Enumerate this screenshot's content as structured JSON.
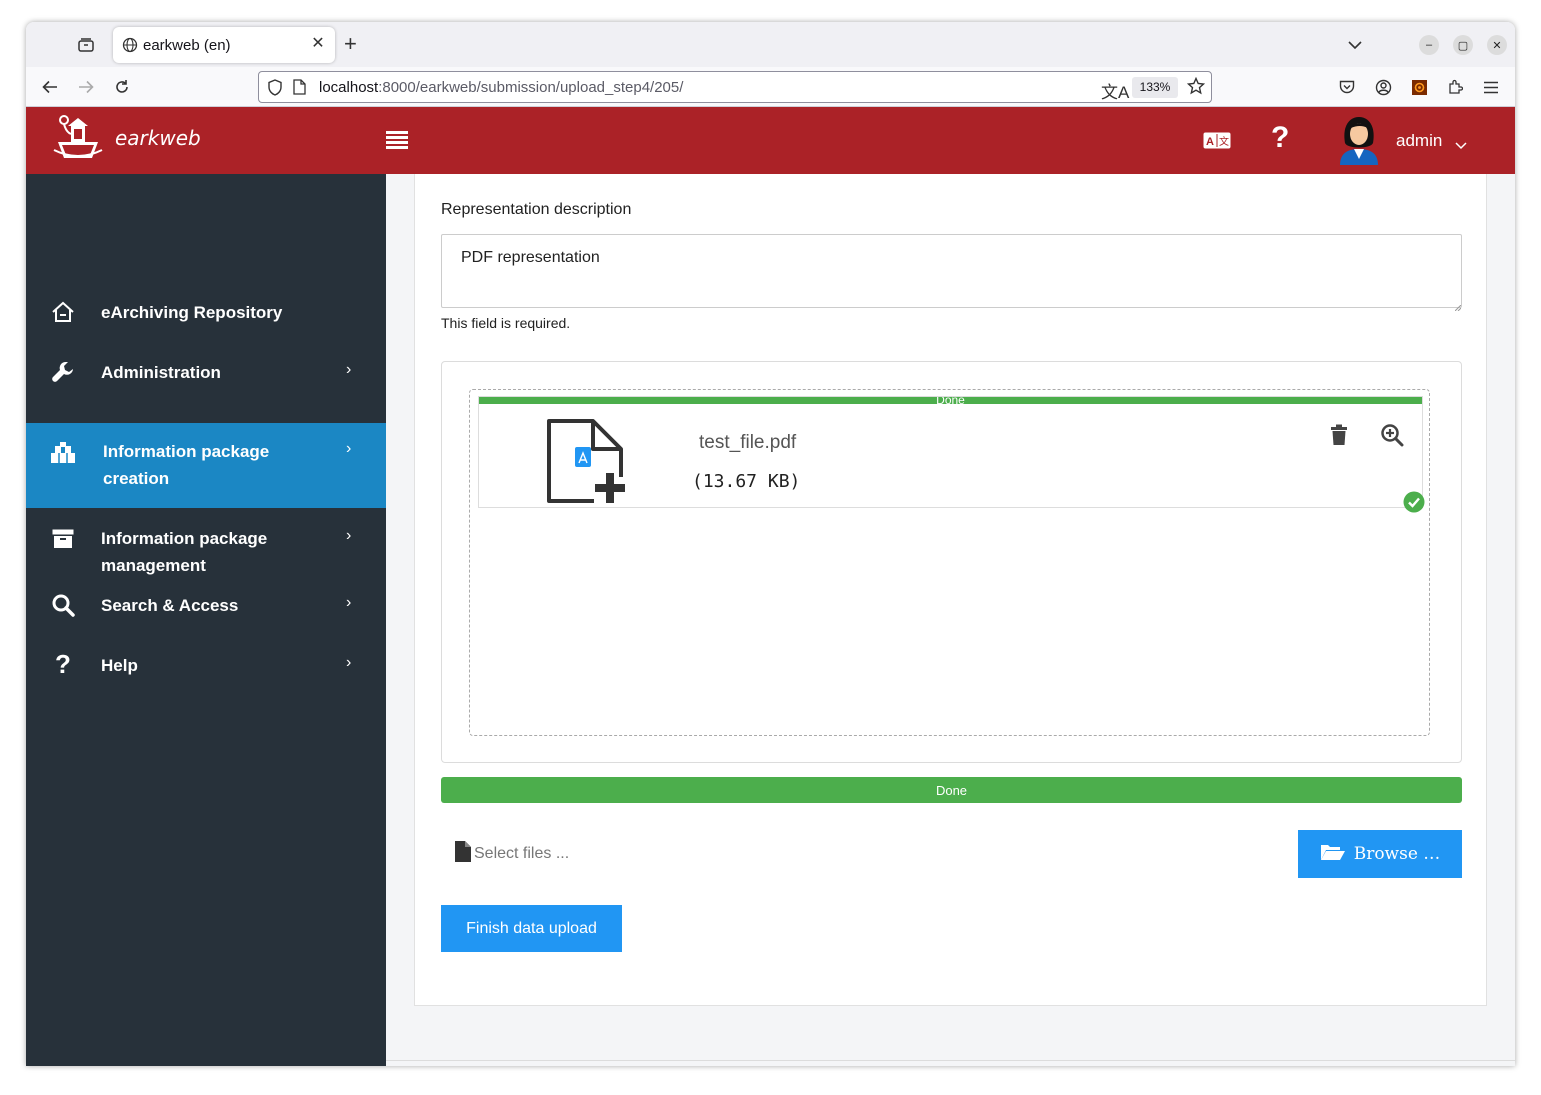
{
  "browser": {
    "tab_title": "earkweb (en)",
    "url_host": "localhost",
    "url_path": ":8000/earkweb/submission/upload_step4/205/",
    "zoom": "133%"
  },
  "header": {
    "brand": "earkweb",
    "user": "admin",
    "help_icon": "?"
  },
  "sidebar": {
    "items": [
      {
        "label": "eArchiving Repository",
        "icon": "home-icon"
      },
      {
        "label": "Administration",
        "icon": "wrench-icon"
      },
      {
        "label": "Information package creation",
        "icon": "package-creation-icon",
        "active": true
      },
      {
        "label": "Information package management",
        "icon": "archive-box-icon"
      },
      {
        "label": "Search & Access",
        "icon": "search-icon"
      },
      {
        "label": "Help",
        "icon": "question-icon"
      }
    ]
  },
  "form": {
    "rep_desc_label": "Representation description",
    "rep_desc_value": "PDF representation",
    "required_text": "This field is required."
  },
  "upload": {
    "file_name": "test_file.pdf",
    "file_size": "(13.67 KB)",
    "file_progress_label": "Done",
    "overall_progress_label": "Done",
    "select_placeholder": "Select files ...",
    "browse_label": "Browse …",
    "finish_label": "Finish data upload"
  },
  "colors": {
    "header": "#ab2227",
    "sidebar": "#27313a",
    "sidebar_active": "#1b87c4",
    "progress": "#4cae4c",
    "button": "#2196f3"
  }
}
